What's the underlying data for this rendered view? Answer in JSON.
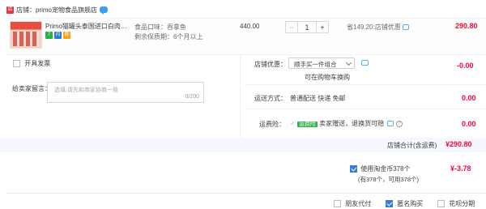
{
  "shop": {
    "label": "店铺：primo宠物食品旗舰店"
  },
  "item": {
    "title": "Primo猫罐头泰国进口白肉营养...",
    "badges": [
      "7",
      "闪",
      "券"
    ],
    "spec_flavor": "食品口味：吞拿鱼",
    "spec_shelf_life": "剩余保质期：6个月以上",
    "unit_price": "440.00",
    "quantity": "1",
    "saving": "省149.20:店铺优惠",
    "subtotal": "290.80"
  },
  "invoice": {
    "label": "开具发票"
  },
  "message": {
    "label": "给卖家留言：",
    "placeholder": "选填,请先和商家协商一致",
    "counter": "0/200"
  },
  "shop_discount": {
    "label": "店铺优惠：",
    "selected": "顺手买一件组合",
    "hint": "可在购物车换购",
    "value": "-0.00"
  },
  "shipping": {
    "label": "运送方式：",
    "method": "普通配送 快递 免邮",
    "value": "0.00"
  },
  "insurance": {
    "label": "运费险：",
    "tag": "运费险",
    "text": "卖家赠送，退换货可赔",
    "value": "0.00"
  },
  "shop_total": {
    "label": "店铺合计(含运费)",
    "value": "¥290.80"
  },
  "coins": {
    "label": "使用淘金币378个",
    "sub": "(有378个，可用378个)",
    "value": "¥-3.78"
  },
  "footer_options": {
    "friend_pay": "朋友代付",
    "anonymous": "匿名购买",
    "huabei": "花呗分期"
  }
}
